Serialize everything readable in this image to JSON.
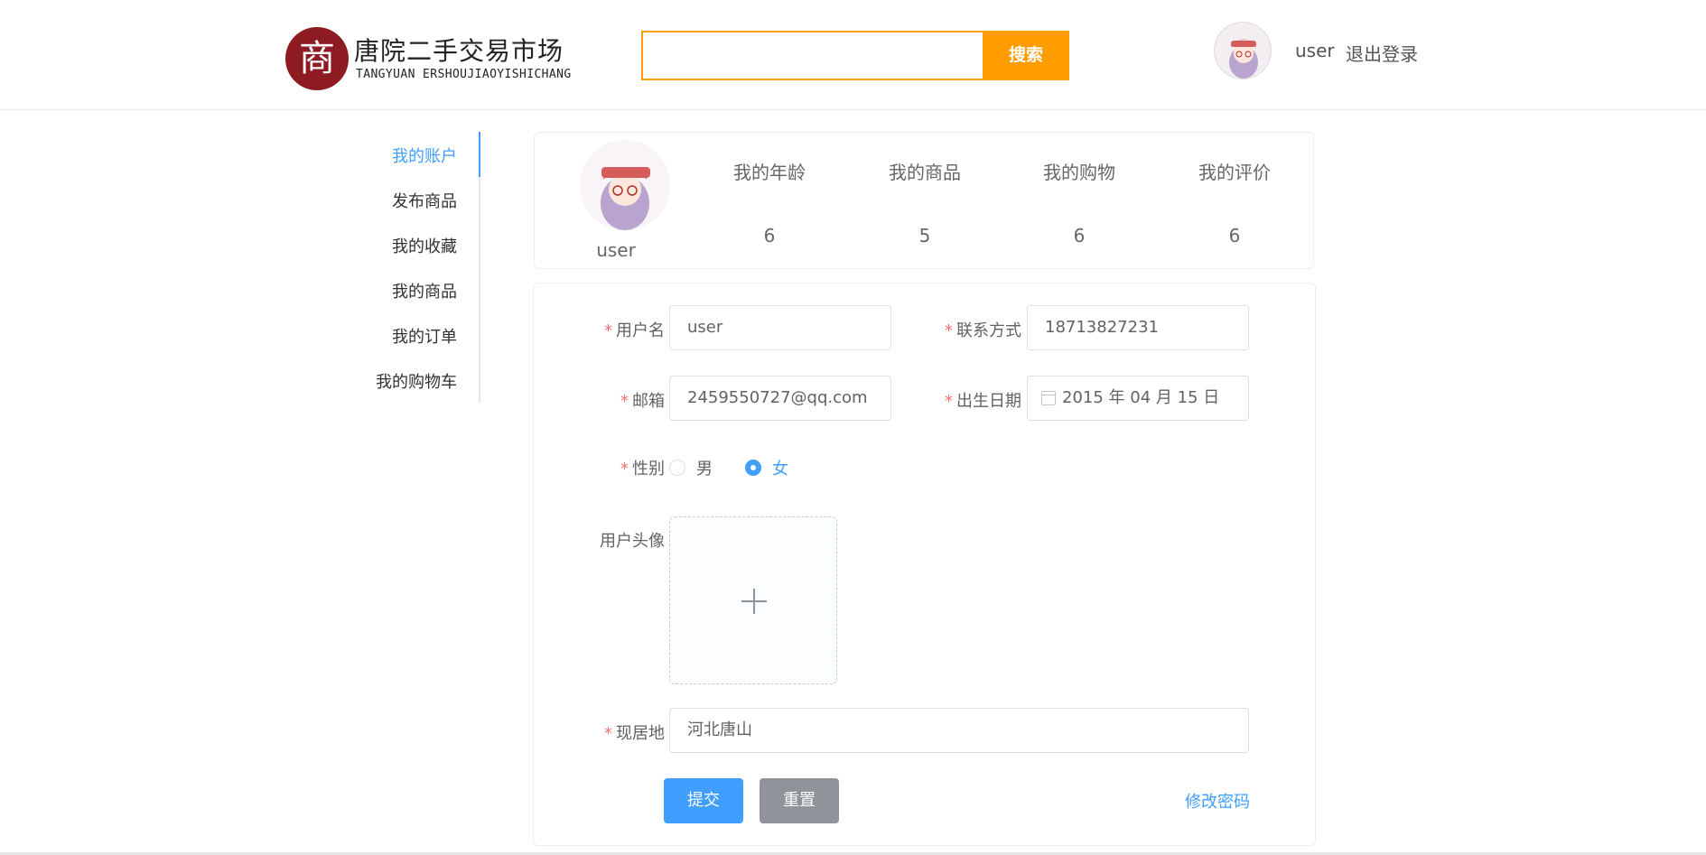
{
  "header": {
    "logo_glyph": "商",
    "logo_cn": "唐院二手交易市场",
    "logo_en": "TANGYUAN ERSHOUJIAOYISHICHANG",
    "search_placeholder": "",
    "search_button": "搜索",
    "username": "user",
    "logout": "退出登录"
  },
  "sidebar": {
    "items": [
      {
        "label": "我的账户",
        "active": true
      },
      {
        "label": "发布商品"
      },
      {
        "label": "我的收藏"
      },
      {
        "label": "我的商品"
      },
      {
        "label": "我的订单"
      },
      {
        "label": "我的购物车"
      }
    ]
  },
  "stats": {
    "username": "user",
    "columns": [
      {
        "label": "我的年龄",
        "value": "6"
      },
      {
        "label": "我的商品",
        "value": "5"
      },
      {
        "label": "我的购物",
        "value": "6"
      },
      {
        "label": "我的评价",
        "value": "6"
      }
    ]
  },
  "form": {
    "username_label": "用户名",
    "username_value": "user",
    "contact_label": "联系方式",
    "contact_value": "18713827231",
    "email_label": "邮箱",
    "email_value": "2459550727@qq.com",
    "birth_label": "出生日期",
    "birth_value": "2015 年 04 月 15 日",
    "gender_label": "性别",
    "gender_male": "男",
    "gender_female": "女",
    "gender_selected": "女",
    "avatar_label": "用户头像",
    "address_label": "现居地",
    "address_value": "河北唐山",
    "required_mark": "*",
    "submit": "提交",
    "reset": "重置",
    "change_password": "修改密码"
  },
  "colors": {
    "accent": "#409eff",
    "search": "#ff9c00",
    "logo": "#8e1b22",
    "required": "#f56c6c"
  }
}
